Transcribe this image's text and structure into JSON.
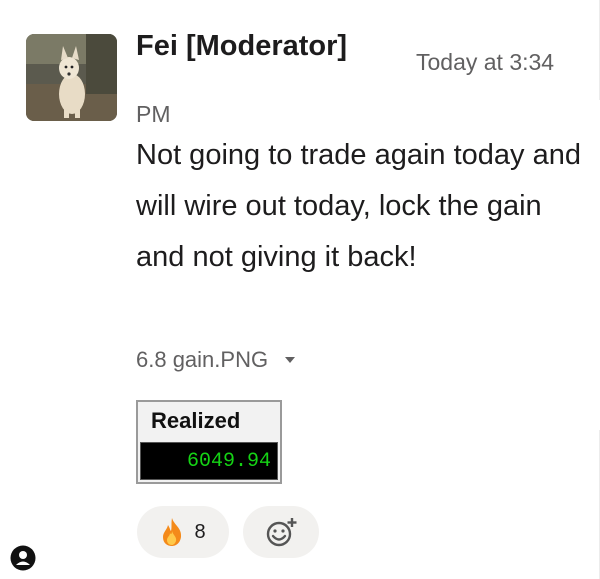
{
  "message": {
    "author": "Fei [Moderator]",
    "timestamp": "Today at 3:34 PM",
    "text": "Not going to trade again today and will wire out today, lock the gain and not giving it back!",
    "avatar_icon": "dog-avatar"
  },
  "attachment": {
    "filename": "6.8 gain.PNG",
    "toggle_icon": "caret-down-icon",
    "preview": {
      "label": "Realized",
      "value": "6049.94"
    }
  },
  "reactions": [
    {
      "icon": "fire-emoji",
      "count": "8"
    }
  ],
  "add_reaction_icon": "add-emoji-icon",
  "corner_icon": "profile-icon",
  "colors": {
    "value_text": "#15d315",
    "reaction_bg": "#f2f1ef",
    "meta_text": "#616061"
  }
}
